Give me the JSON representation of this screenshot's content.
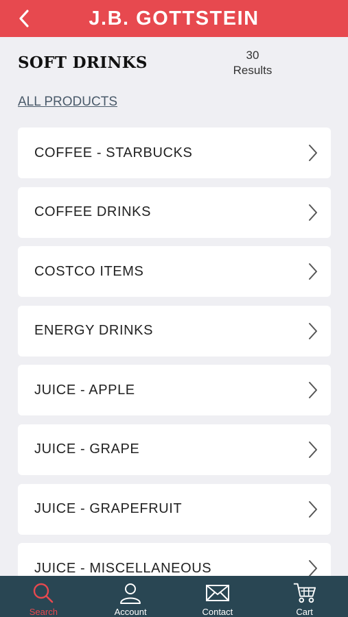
{
  "header": {
    "brand": "J.B. GOTTSTEIN",
    "back_icon": "chevron-left-icon",
    "color": "#e7494f"
  },
  "page": {
    "title": "SOFT DRINKS",
    "results_count": "30",
    "results_label": "Results",
    "all_products_link": "ALL PRODUCTS"
  },
  "categories": [
    {
      "label": "COFFEE - STARBUCKS"
    },
    {
      "label": "COFFEE DRINKS"
    },
    {
      "label": "COSTCO ITEMS"
    },
    {
      "label": "ENERGY DRINKS"
    },
    {
      "label": "JUICE - APPLE"
    },
    {
      "label": "JUICE - GRAPE"
    },
    {
      "label": "JUICE - GRAPEFRUIT"
    },
    {
      "label": "JUICE - MISCELLANEOUS"
    }
  ],
  "tabbar": {
    "background": "#294653",
    "active_color": "#e7494f",
    "tabs": [
      {
        "label": "Search",
        "icon": "search-icon",
        "active": true
      },
      {
        "label": "Account",
        "icon": "user-icon",
        "active": false
      },
      {
        "label": "Contact",
        "icon": "envelope-icon",
        "active": false
      },
      {
        "label": "Cart",
        "icon": "cart-icon",
        "active": false
      }
    ]
  }
}
